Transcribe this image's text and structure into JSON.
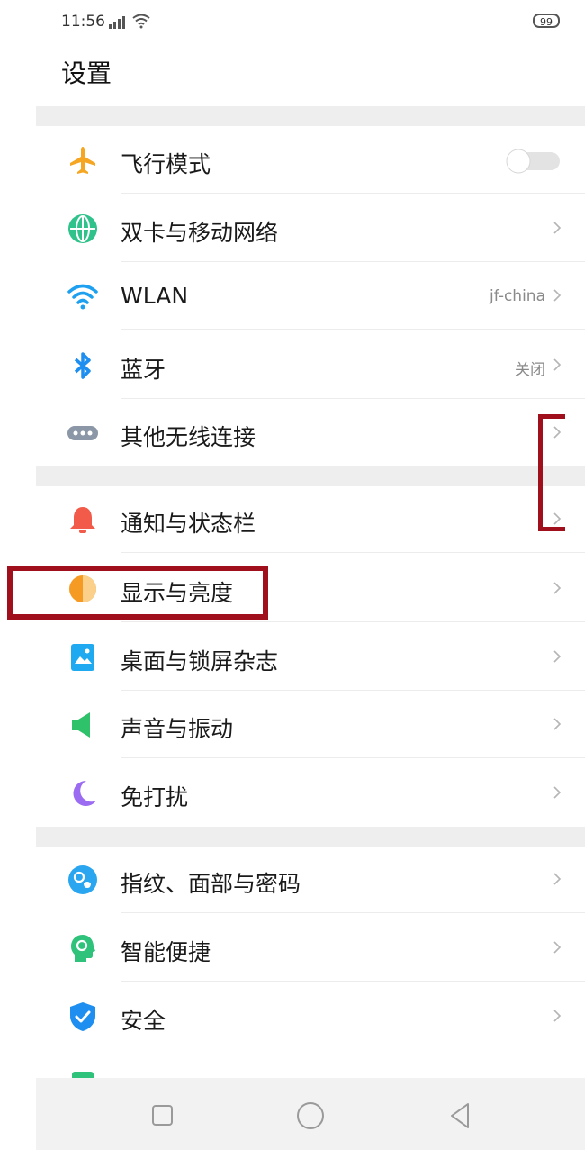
{
  "status": {
    "time": "11:56",
    "battery": "99"
  },
  "title": "设置",
  "items": [
    {
      "label": "飞行模式",
      "value": "",
      "icon": "airplane-icon",
      "color": "#f5a623"
    },
    {
      "label": "双卡与移动网络",
      "value": "",
      "icon": "globe-icon",
      "color": "#2fc28a"
    },
    {
      "label": "WLAN",
      "value": "jf-china",
      "icon": "wifi-icon",
      "color": "#1ea0f0"
    },
    {
      "label": "蓝牙",
      "value": "关闭",
      "icon": "bluetooth-icon",
      "color": "#1e8ff0"
    },
    {
      "label": "其他无线连接",
      "value": "",
      "icon": "more-icon",
      "color": "#8b96a6"
    },
    {
      "label": "通知与状态栏",
      "value": "",
      "icon": "bell-icon",
      "color": "#f25a4a"
    },
    {
      "label": "显示与亮度",
      "value": "",
      "icon": "brightness-icon",
      "color": "#f59a23"
    },
    {
      "label": "桌面与锁屏杂志",
      "value": "",
      "icon": "wallpaper-icon",
      "color": "#1ea9f0"
    },
    {
      "label": "声音与振动",
      "value": "",
      "icon": "speaker-icon",
      "color": "#2fc26a"
    },
    {
      "label": "免打扰",
      "value": "",
      "icon": "moon-icon",
      "color": "#9b6bf2"
    },
    {
      "label": "指纹、面部与密码",
      "value": "",
      "icon": "fingerprint-icon",
      "color": "#2aa6f0"
    },
    {
      "label": "智能便捷",
      "value": "",
      "icon": "smart-icon",
      "color": "#2fc27a"
    },
    {
      "label": "安全",
      "value": "",
      "icon": "shield-icon",
      "color": "#1e8ff0"
    }
  ],
  "airplane_mode_on": false
}
